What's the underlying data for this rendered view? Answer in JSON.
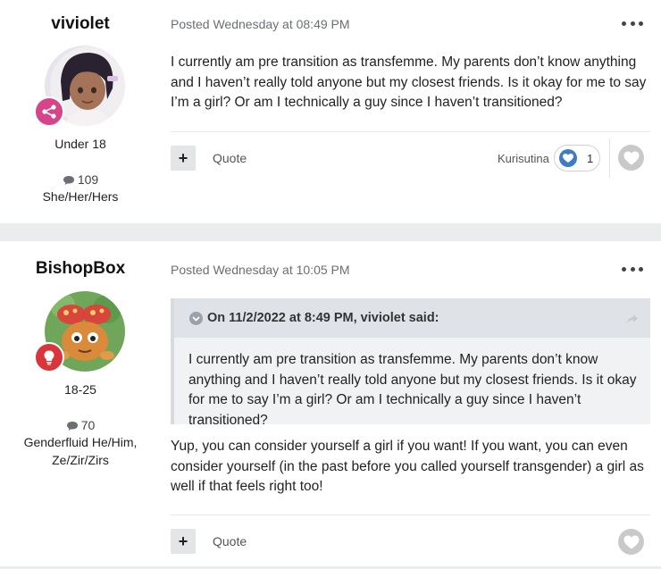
{
  "posts": [
    {
      "username": "viviolet",
      "group": "Under 18",
      "post_count": "109",
      "pronouns": "She/Her/Hers",
      "badge_icon": "share-nodes-icon",
      "badge_color": "#d6448a",
      "timestamp": "Posted Wednesday at 08:49 PM",
      "body": "I currently am pre transition as transfemme. My parents don’t know anything and I haven’t really told anyone but my closest friends. Is it okay for me to say I’m a girl? Or am I technically a guy since I haven’t transitioned?",
      "plus_label": "+",
      "quote_label": "Quote",
      "reaction_user": "Kurisutina",
      "reaction_count": "1"
    },
    {
      "username": "BishopBox",
      "group": "18-25",
      "post_count": "70",
      "pronouns": "Genderfluid He/Him, Ze/Zir/Zirs",
      "badge_icon": "lightbulb-icon",
      "badge_color": "#d8363a",
      "timestamp": "Posted Wednesday at 10:05 PM",
      "quote": {
        "header": "On 11/2/2022 at 8:49 PM, viviolet said:",
        "body": "I currently am pre transition as transfemme. My parents don’t know anything and I haven’t really told anyone but my closest friends. Is it okay for me to say I’m a girl? Or am I technically a guy since I haven’t transitioned?"
      },
      "body": "Yup, you can consider yourself a girl if you want! If you want, you can even consider yourself (in the past before you called yourself transgender) a girl as well if that feels right too!",
      "plus_label": "+",
      "quote_label": "Quote"
    }
  ]
}
